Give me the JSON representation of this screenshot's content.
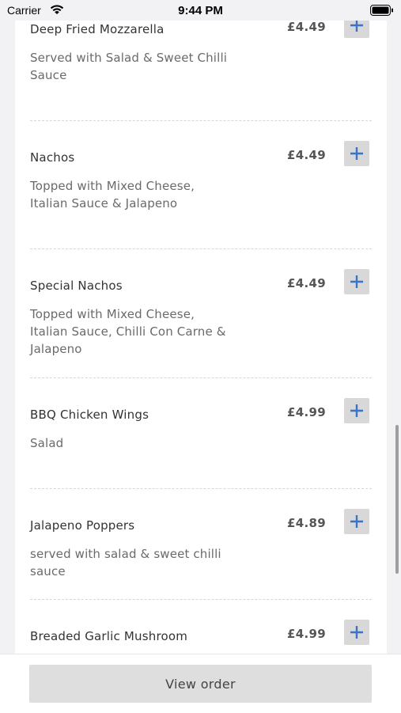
{
  "status_bar": {
    "carrier": "Carrier",
    "time": "9:44 PM"
  },
  "menu": {
    "currency_color": "#555555",
    "add_icon_color": "#3a73c9",
    "items": [
      {
        "name": "Deep Fried Mozzarella",
        "price": "£4.49",
        "description": "Served with Salad & Sweet Chilli Sauce"
      },
      {
        "name": "Nachos",
        "price": "£4.49",
        "description": "Topped with Mixed Cheese, Italian Sauce & Jalapeno"
      },
      {
        "name": "Special Nachos",
        "price": "£4.49",
        "description": "Topped with Mixed Cheese, Italian Sauce, Chilli Con Carne & Jalapeno"
      },
      {
        "name": "BBQ Chicken Wings",
        "price": "£4.99",
        "description": "Salad"
      },
      {
        "name": "Jalapeno Poppers",
        "price": "£4.89",
        "description": "served with salad & sweet chilli sauce"
      },
      {
        "name": "Breaded Garlic Mushroom",
        "price": "£4.99",
        "description": ""
      }
    ]
  },
  "footer": {
    "view_order_label": "View order"
  }
}
